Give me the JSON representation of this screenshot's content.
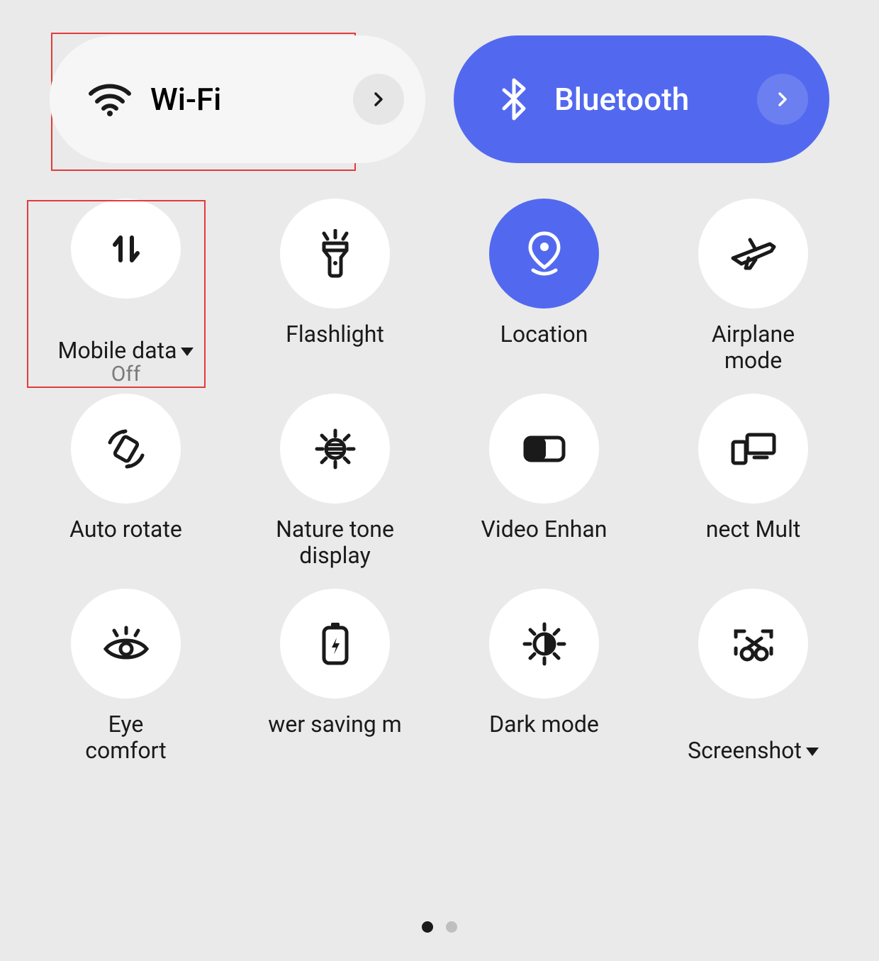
{
  "accent_color": "#5269ef",
  "highlight_color": "#e23b3b",
  "top_toggles": {
    "wifi": {
      "label": "Wi-Fi",
      "active": false
    },
    "bluetooth": {
      "label": "Bluetooth",
      "active": true
    }
  },
  "tiles": [
    {
      "id": "mobile-data",
      "label": "Mobile data",
      "sub": "Off",
      "active": false,
      "dropdown": true
    },
    {
      "id": "flashlight",
      "label": "Flashlight",
      "sub": "",
      "active": false,
      "dropdown": false
    },
    {
      "id": "location",
      "label": "Location",
      "sub": "",
      "active": true,
      "dropdown": false
    },
    {
      "id": "airplane",
      "label": "Airplane\nmode",
      "sub": "",
      "active": false,
      "dropdown": false
    },
    {
      "id": "auto-rotate",
      "label": "Auto rotate",
      "sub": "",
      "active": false,
      "dropdown": false
    },
    {
      "id": "nature-tone",
      "label": "Nature tone\ndisplay",
      "sub": "",
      "active": false,
      "dropdown": false
    },
    {
      "id": "video-enhance",
      "label": "Video Enhan",
      "sub": "",
      "active": false,
      "dropdown": false
    },
    {
      "id": "multi-screen",
      "label": "nect     Mult",
      "sub": "",
      "active": false,
      "dropdown": false
    },
    {
      "id": "eye-comfort",
      "label": "Eye\ncomfort",
      "sub": "",
      "active": false,
      "dropdown": false
    },
    {
      "id": "power-saving",
      "label": "wer saving m",
      "sub": "",
      "active": false,
      "dropdown": false
    },
    {
      "id": "dark-mode",
      "label": "Dark mode",
      "sub": "",
      "active": false,
      "dropdown": false
    },
    {
      "id": "screenshot",
      "label": "Screenshot",
      "sub": "",
      "active": false,
      "dropdown": true
    }
  ],
  "page_indicator": {
    "count": 2,
    "active": 0
  }
}
